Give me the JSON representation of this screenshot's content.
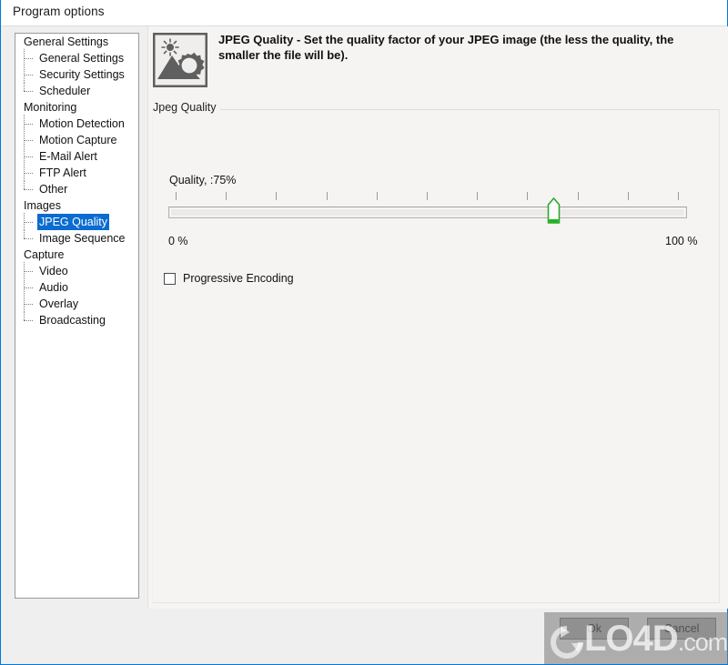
{
  "window": {
    "title": "Program options",
    "accent_color": "#0078d7",
    "titlebar_bg": "#ffffff",
    "body_bg": "#efefef"
  },
  "tree": {
    "selected": "JPEG Quality",
    "selection_color": "#0a6cd0",
    "items": [
      {
        "label": "General Settings",
        "level": "root"
      },
      {
        "label": "General Settings",
        "level": "child"
      },
      {
        "label": "Security Settings",
        "level": "child"
      },
      {
        "label": "Scheduler",
        "level": "child",
        "last": true
      },
      {
        "label": "Monitoring",
        "level": "root"
      },
      {
        "label": "Motion Detection",
        "level": "child"
      },
      {
        "label": "Motion Capture",
        "level": "child"
      },
      {
        "label": "E-Mail Alert",
        "level": "child"
      },
      {
        "label": "FTP Alert",
        "level": "child"
      },
      {
        "label": "Other",
        "level": "child",
        "last": true
      },
      {
        "label": "Images",
        "level": "root"
      },
      {
        "label": "JPEG Quality",
        "level": "child",
        "selected": true
      },
      {
        "label": "Image Sequence",
        "level": "child",
        "last": true
      },
      {
        "label": "Capture",
        "level": "root"
      },
      {
        "label": "Video",
        "level": "child"
      },
      {
        "label": "Audio",
        "level": "child"
      },
      {
        "label": "Overlay",
        "level": "child"
      },
      {
        "label": "Broadcasting",
        "level": "child",
        "last": true
      }
    ]
  },
  "header": {
    "icon": "image-settings-icon",
    "description": "JPEG Quality - Set the quality factor of your JPEG image (the less the quality, the smaller the file will be)."
  },
  "group": {
    "label": "Jpeg Quality"
  },
  "slider": {
    "value_label": "Quality, :75%",
    "value": 75,
    "min": 0,
    "max": 100,
    "min_label": "0 %",
    "max_label": "100 %",
    "tick_count": 11,
    "thumb_color": "#2ea82e"
  },
  "progressive": {
    "label": "Progressive Encoding",
    "checked": false
  },
  "buttons": {
    "ok": "Ok",
    "cancel": "Cancel"
  },
  "watermark": {
    "brand": "LO4D",
    "domain": ".com",
    "logo": "refresh-arrows-icon"
  }
}
